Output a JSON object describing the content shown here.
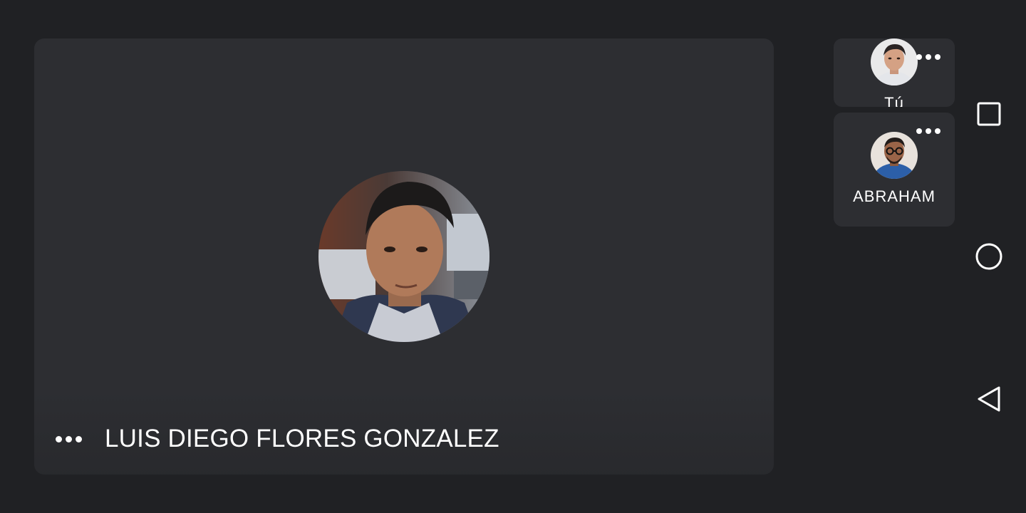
{
  "main_participant": {
    "name": "LUIS DIEGO FLORES GONZALEZ",
    "menu_icon": "more-horizontal-icon",
    "avatar_icon": "profile-photo"
  },
  "side_participants": [
    {
      "name": "Tú",
      "menu_icon": "more-horizontal-icon",
      "avatar_icon": "profile-photo"
    },
    {
      "name": "ABRAHAM",
      "menu_icon": "more-horizontal-icon",
      "avatar_icon": "profile-photo"
    }
  ],
  "navigation_bar": {
    "recents_icon": "square-recents-icon",
    "home_icon": "circle-home-icon",
    "back_icon": "triangle-back-icon"
  },
  "colors": {
    "background": "#202124",
    "tile": "#2d2e32",
    "text": "#ffffff"
  }
}
